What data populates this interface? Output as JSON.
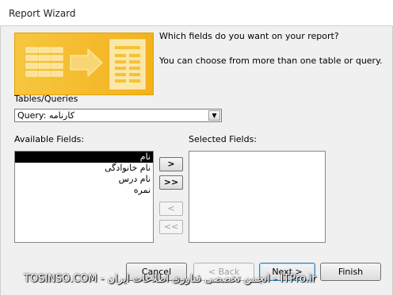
{
  "window": {
    "title": "Report Wizard"
  },
  "intro": {
    "question": "Which fields do you want on your report?",
    "hint": "You can choose from more than one table or query."
  },
  "source": {
    "label": "Tables/Queries",
    "value": "Query: کارنامه"
  },
  "available": {
    "label": "Available Fields:",
    "items": [
      "نام",
      "نام خانوادگی",
      "نام درس",
      "نمره"
    ],
    "selected_index": 0
  },
  "selected_fields": {
    "label": "Selected Fields:",
    "items": []
  },
  "move_buttons": {
    "add_one": ">",
    "add_all": ">>",
    "remove_one": "<",
    "remove_all": "<<"
  },
  "footer": {
    "cancel": "Cancel",
    "back": "< Back",
    "next": "Next >",
    "finish": "Finish"
  },
  "watermark": "TOSINSO.COM - انجمن تخصصی فناوری اطلاعات ایران - ITPro.ir",
  "colors": {
    "banner": "#f3b21d",
    "selection": "#000000"
  }
}
